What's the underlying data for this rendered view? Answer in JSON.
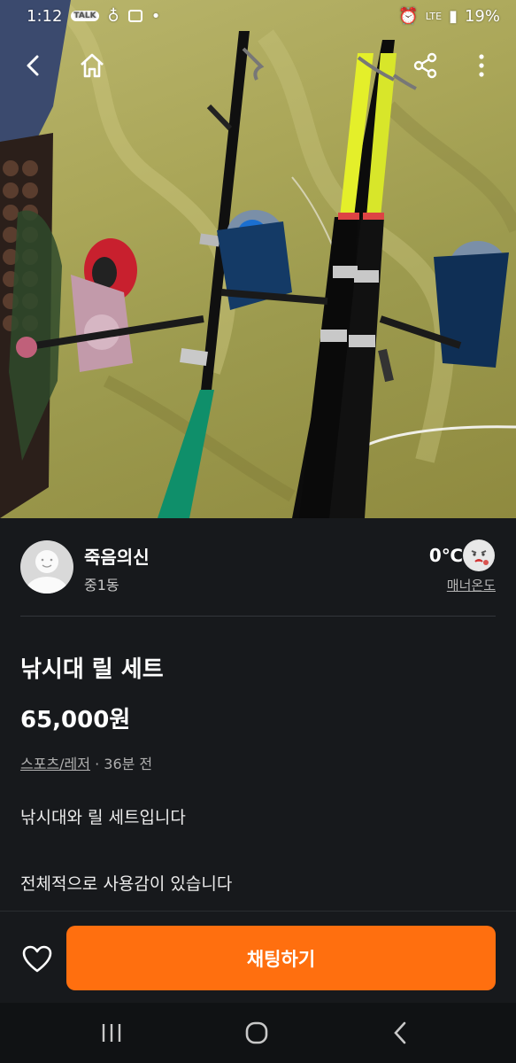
{
  "status_bar": {
    "time": "1:12",
    "network": "LTE",
    "battery": "19%"
  },
  "nav": {
    "back_icon": "chevron-left-icon",
    "home_icon": "home-icon",
    "share_icon": "share-icon",
    "more_icon": "more-vertical-icon"
  },
  "seller": {
    "name": "죽음의신",
    "location": "중1동",
    "temperature": "0℃",
    "manner_label": "매너온도"
  },
  "item": {
    "title": "낚시대 릴 세트",
    "price": "65,000원",
    "category": "스포츠/레저",
    "time_ago": " · 36분 전",
    "description_line1": "낚시대와 릴 세트입니다",
    "description_line2": "전체적으로 사용감이 있습니다"
  },
  "actions": {
    "chat_label": "채팅하기",
    "accent_color": "#ff6f0f"
  },
  "system_nav": {
    "recents_icon": "recents-icon",
    "home_icon": "circle-home-icon",
    "back_icon": "chevron-left-icon"
  }
}
